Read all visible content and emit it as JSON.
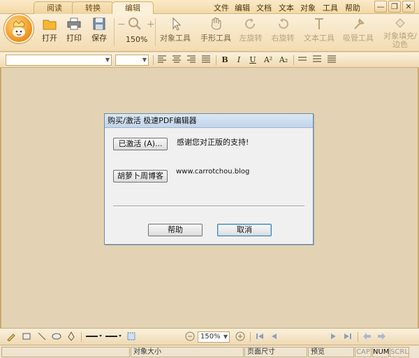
{
  "tabs": [
    {
      "label": "阅读",
      "active": false
    },
    {
      "label": "转换",
      "active": false
    },
    {
      "label": "编辑",
      "active": true
    }
  ],
  "menu": [
    "文件",
    "编辑",
    "文档",
    "文本",
    "对象",
    "工具",
    "帮助"
  ],
  "window_controls": {
    "minimize": "—",
    "restore": "❐",
    "close": "✕"
  },
  "ribbon": {
    "open": "打开",
    "print": "打印",
    "save": "保存",
    "zoom_level": "150%",
    "zoom_out": "−",
    "zoom_in": "+",
    "object_tool": "对象工具",
    "hand_tool": "手形工具",
    "rotate_left": "左旋转",
    "rotate_right": "右旋转",
    "text_tool": "文本工具",
    "eyedropper": "吸管工具",
    "object_fill": "对象填充/边色"
  },
  "format": {
    "font_family": "",
    "font_size": "",
    "bold": "B",
    "italic": "I",
    "underline": "U",
    "superscript": "A²",
    "subscript": "A₂"
  },
  "dialog": {
    "title": "购买/激活 极速PDF编辑器",
    "activated_button": "已激活 (A)...",
    "thanks_text": "感谢您对正版的支持!",
    "blog_button": "胡萝卜周博客",
    "blog_url": "www.carrotchou.blog",
    "help_button": "帮助",
    "cancel_button": "取消"
  },
  "bottom": {
    "zoom": "150%"
  },
  "status": {
    "object_size": "对象大小",
    "page_size": "页面尺寸",
    "preview": "预览",
    "cap": "CAP",
    "num": "NUM",
    "scrl": "SCRL"
  }
}
